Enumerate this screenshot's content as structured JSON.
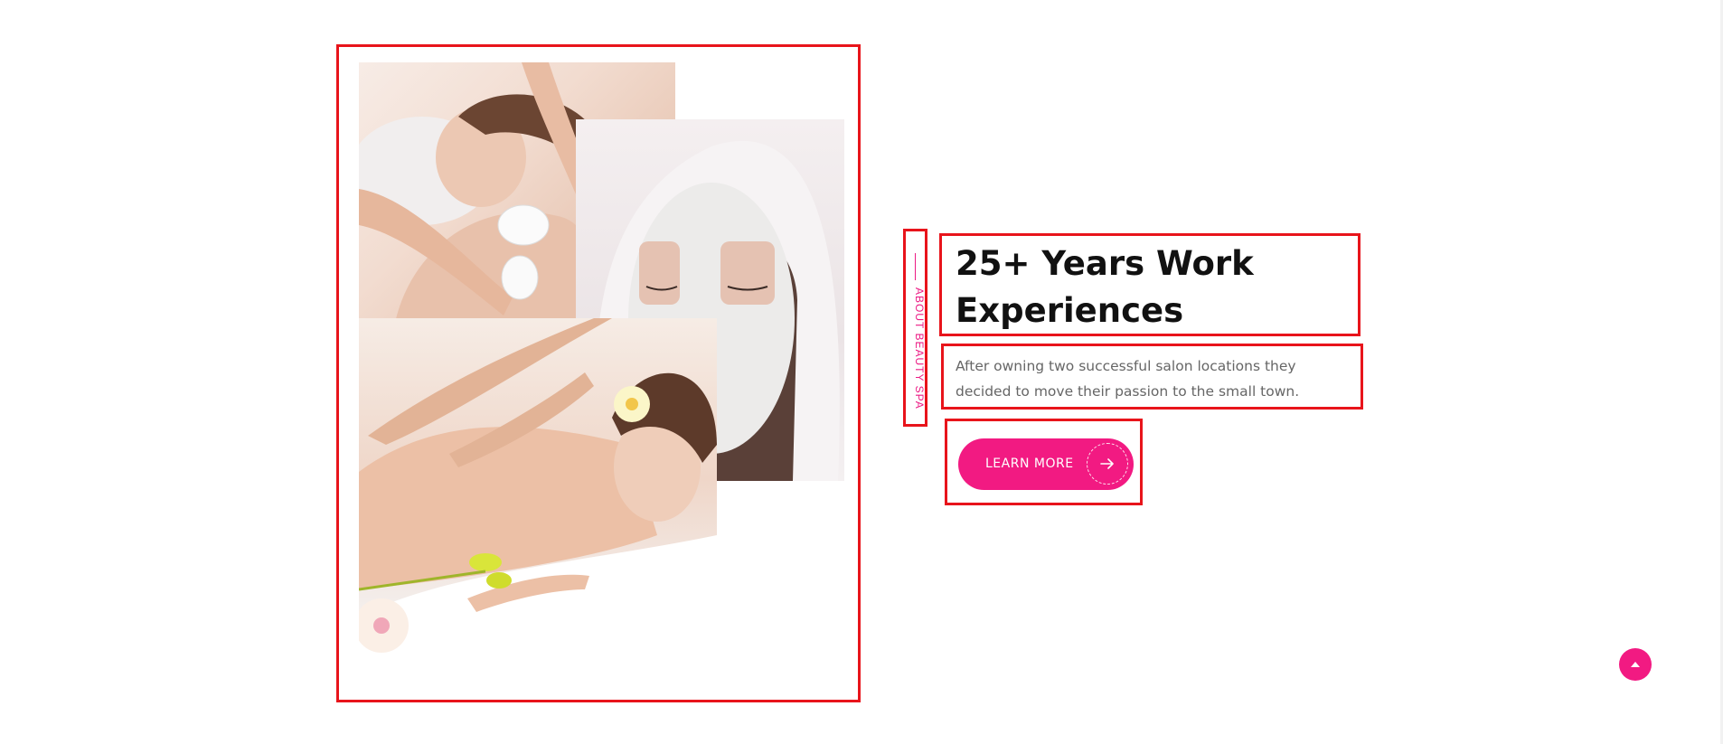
{
  "collage": {
    "images": [
      {
        "name": "hot-stone-massage-photo"
      },
      {
        "name": "face-mask-photo"
      },
      {
        "name": "back-massage-photo"
      }
    ]
  },
  "about": {
    "label": "ABOUT BEAUTY SPA"
  },
  "heading": {
    "line1": "25+ Years Work",
    "line2": "Experiences"
  },
  "description": {
    "text": "After owning two successful salon locations they decided to move their passion to the small town."
  },
  "cta": {
    "label": "LEARN MORE",
    "icon": "arrow-right-icon"
  },
  "back_to_top": {
    "icon": "chevron-up-icon"
  },
  "colors": {
    "accent": "#f21a82",
    "annotation_border": "#e8141b",
    "heading_text": "#111111",
    "body_text": "#666666"
  }
}
